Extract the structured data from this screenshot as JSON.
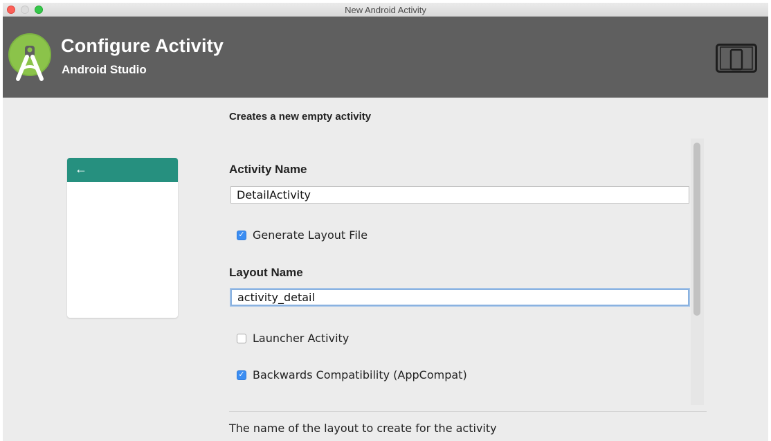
{
  "window": {
    "title": "New Android Activity"
  },
  "header": {
    "title": "Configure Activity",
    "subtitle": "Android Studio",
    "logo_icon": "android-studio-logo-icon",
    "device_icon": "tablet-phone-icon",
    "background": "#5f5f5f"
  },
  "content": {
    "description": "Creates a new empty activity",
    "preview": {
      "bar_color": "#26907f",
      "back_icon": "arrow-left-icon",
      "back_glyph": "←"
    },
    "activity_name": {
      "label": "Activity Name",
      "value": "DetailActivity"
    },
    "generate_layout": {
      "label": "Generate Layout File",
      "checked": true
    },
    "layout_name": {
      "label": "Layout Name",
      "value": "activity_detail"
    },
    "launcher_activity": {
      "label": "Launcher Activity",
      "checked": false
    },
    "backwards_compat": {
      "label": "Backwards Compatibility (AppCompat)",
      "checked": true
    },
    "check_glyph": "✓"
  },
  "footer": {
    "help_text": "The name of the layout to create for the activity"
  }
}
